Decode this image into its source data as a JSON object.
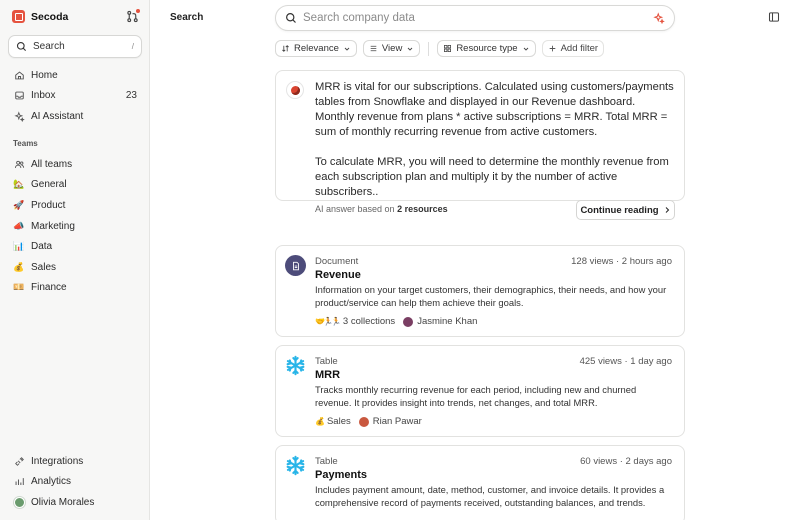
{
  "app": {
    "name": "Secoda"
  },
  "sidebar": {
    "search_label": "Search",
    "search_shortcut": "/",
    "items": [
      {
        "label": "Home",
        "icon": "home-icon"
      },
      {
        "label": "Inbox",
        "icon": "inbox-icon",
        "count": "23"
      },
      {
        "label": "AI Assistant",
        "icon": "sparkle-icon"
      }
    ],
    "teams_label": "Teams",
    "teams": [
      {
        "label": "All teams",
        "icon": "people-icon"
      },
      {
        "label": "General",
        "icon": "🏡"
      },
      {
        "label": "Product",
        "icon": "🚀"
      },
      {
        "label": "Marketing",
        "icon": "📣"
      },
      {
        "label": "Data",
        "icon": "📊"
      },
      {
        "label": "Sales",
        "icon": "💰"
      },
      {
        "label": "Finance",
        "icon": "💴"
      }
    ],
    "bottom": [
      {
        "label": "Integrations",
        "icon": "plug-icon"
      },
      {
        "label": "Analytics",
        "icon": "bar-chart-icon"
      },
      {
        "label": "Olivia Morales",
        "icon": "avatar"
      }
    ]
  },
  "header": {
    "title": "Search",
    "search_placeholder": "Search company data"
  },
  "filters": [
    {
      "label": "Relevance",
      "icon": "sort-icon"
    },
    {
      "label": "View",
      "icon": "list-icon"
    },
    {
      "label": "Resource type",
      "icon": "grid-icon"
    }
  ],
  "add_filter_label": "Add filter",
  "ai_answer": {
    "paragraph1": "MRR is vital for our subscriptions. Calculated using customers/payments tables from Snowflake and displayed in our Revenue dashboard. Monthly revenue from plans * active subscriptions = MRR. Total MRR = sum of monthly recurring revenue from active customers.",
    "paragraph2": "To calculate MRR, you will need to determine the monthly revenue from each subscription plan and multiply it by the number of active subscribers..",
    "footer_prefix": "AI answer based on",
    "footer_resources": "2 resources",
    "continue_label": "Continue reading"
  },
  "results": [
    {
      "type": "Document",
      "title": "Revenue",
      "meta": "128 views · 2 hours ago",
      "description": "Information on your target customers, their demographics, their needs, and how your product/service can help them achieve their goals.",
      "collections": "3 collections",
      "owner": "Jasmine Khan",
      "icon": "document-icon"
    },
    {
      "type": "Table",
      "title": "MRR",
      "meta": "425 views · 1 day ago",
      "description": "Tracks monthly recurring revenue for each period, including new and churned revenue. It provides insight into trends, net changes, and total MRR.",
      "collections": "Sales",
      "owner": "Rian Pawar",
      "icon": "snowflake-icon"
    },
    {
      "type": "Table",
      "title": "Payments",
      "meta": "60 views · 2 days ago",
      "description": "Includes payment amount, date, method, customer, and invoice details. It provides a comprehensive record of payments received, outstanding balances, and trends.",
      "icon": "snowflake-icon"
    }
  ],
  "colors": {
    "brand": "#e5533f",
    "snowflake": "#29b5e8",
    "doc_icon_bg": "#4d4c7a"
  }
}
